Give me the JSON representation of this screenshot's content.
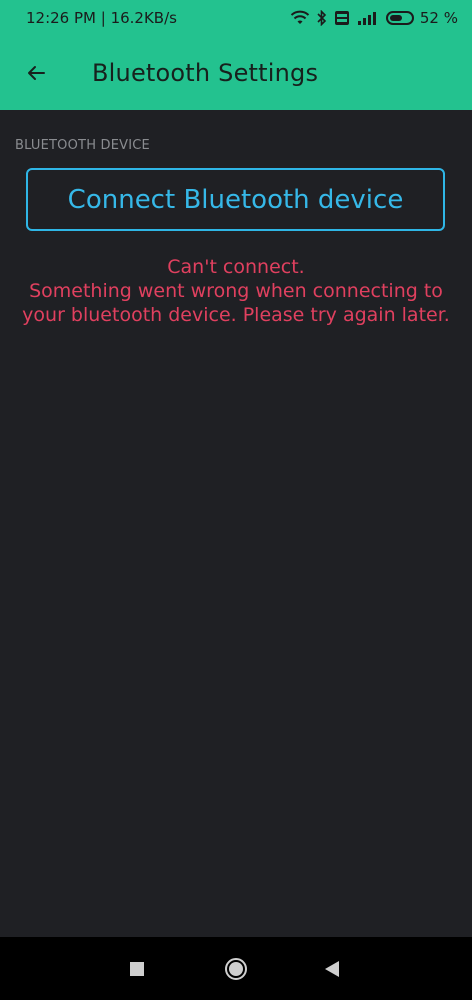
{
  "status_bar": {
    "time_speed": "12:26 PM | 16.2KB/s",
    "battery_percent": "52 %",
    "battery_level": 0.52,
    "icons": [
      "wifi-icon",
      "bluetooth-icon",
      "volte-icon",
      "signal-icon",
      "battery-icon"
    ]
  },
  "app_bar": {
    "title": "Bluetooth Settings",
    "back_icon": "arrow-left-icon"
  },
  "section": {
    "label": "BLUETOOTH DEVICE"
  },
  "connect_button": {
    "label": "Connect Bluetooth device"
  },
  "error": {
    "title": "Can't connect.",
    "message": "Something went wrong when connecting to your bluetooth device. Please try again later."
  },
  "nav_bar": {
    "icons": [
      "recents-square-icon",
      "home-circle-icon",
      "back-triangle-icon"
    ]
  },
  "colors": {
    "accent": "#23c28f",
    "background": "#1f2024",
    "button_border": "#2fb6e6",
    "error": "#e0405f"
  }
}
